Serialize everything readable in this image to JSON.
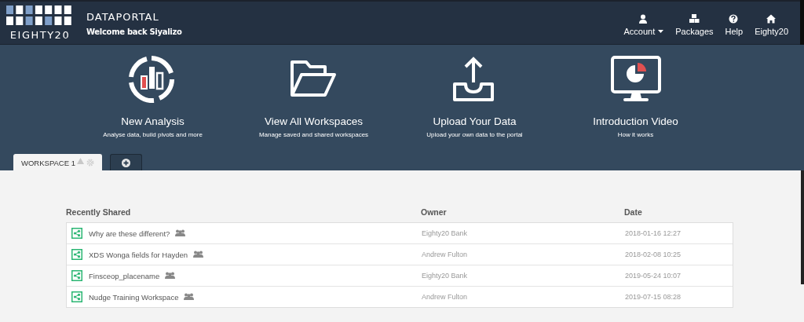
{
  "header": {
    "brand": "EIGHTY20",
    "app_title": "DATAPORTAL",
    "welcome": "Welcome back Siyalizo",
    "nav": [
      {
        "kind": "account",
        "label": "Account",
        "dropdown": true
      },
      {
        "kind": "packages",
        "label": "Packages",
        "dropdown": false
      },
      {
        "kind": "help",
        "label": "Help",
        "dropdown": false
      },
      {
        "kind": "home",
        "label": "Eighty20",
        "dropdown": false
      }
    ]
  },
  "actions": [
    {
      "kind": "analysis",
      "title": "New Analysis",
      "subtitle": "Analyse data, build pivots and more"
    },
    {
      "kind": "folder",
      "title": "View All Workspaces",
      "subtitle": "Manage saved and shared workspaces"
    },
    {
      "kind": "upload",
      "title": "Upload Your Data",
      "subtitle": "Upload your own data to the portal"
    },
    {
      "kind": "video",
      "title": "Introduction Video",
      "subtitle": "How it works"
    }
  ],
  "tabs": [
    {
      "kind": "workspace",
      "label": "WORKSPACE 1",
      "selected": true
    },
    {
      "kind": "add",
      "selected": false
    }
  ],
  "table": {
    "columns": [
      "Recently Shared",
      "Owner",
      "Date"
    ],
    "rows": [
      {
        "name": "Why are these different?",
        "owner": "Eighty20 Bank",
        "date": "2018-01-16 12:27"
      },
      {
        "name": "XDS Wonga fields for Hayden",
        "owner": "Andrew Fulton",
        "date": "2018-02-08 10:25"
      },
      {
        "name": "Finsceop_placename",
        "owner": "Eighty20 Bank",
        "date": "2019-05-24 10:07"
      },
      {
        "name": "Nudge Training Workspace",
        "owner": "Andrew Fulton",
        "date": "2019-07-15 08:28"
      }
    ]
  }
}
